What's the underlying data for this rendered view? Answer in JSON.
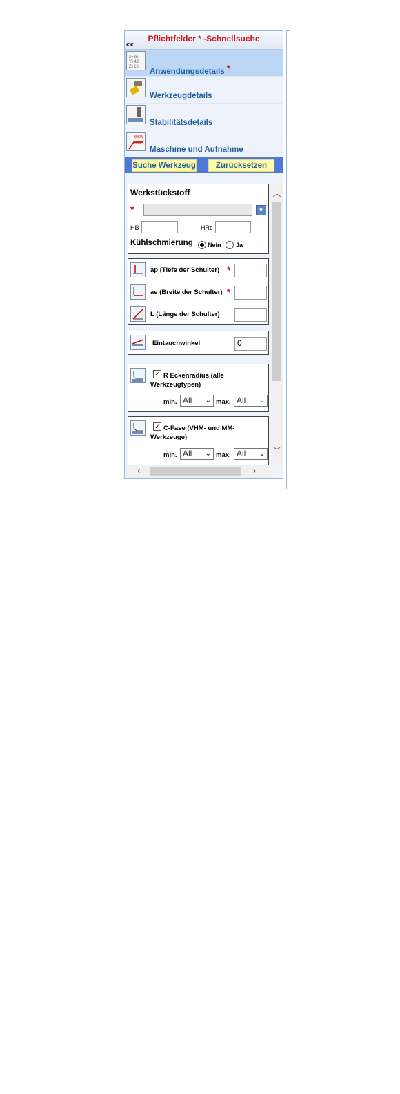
{
  "header": {
    "title": "Pflichtfelder * -Schnellsuche",
    "collapse": "<<"
  },
  "nav": [
    {
      "label": "Anwendungsdetails",
      "icon": "application-details-icon",
      "star": "*"
    },
    {
      "label": "Werkzeugdetails",
      "icon": "tool-details-icon"
    },
    {
      "label": "Stabilitätsdetails",
      "icon": "stability-details-icon"
    },
    {
      "label": "Maschine und Aufnahme",
      "icon": "machine-holder-icon"
    }
  ],
  "actions": {
    "search": "Suche Werkzeug",
    "reset": "Zurücksetzen"
  },
  "workpiece": {
    "title": "Werkstückstoff",
    "required_mark": "*",
    "hb_label": "HB",
    "hrc_label": "HRc",
    "hb_value": "",
    "hrc_value": "",
    "coolant_label": "Kühlschmierung",
    "coolant_options": [
      "Nein",
      "Ja"
    ],
    "coolant_selected": "Nein"
  },
  "shoulder": {
    "ap_label": "ap (Tiefe der Schulter)",
    "ae_label": "ae (Breite der Schulter)",
    "l_label": "L (Länge der Schulter)",
    "required_mark": "*"
  },
  "plunge": {
    "label": "Eintauchwinkel",
    "value": "0"
  },
  "corner_radius": {
    "label": "R Eckenradius (alle Werkzeugtypen)",
    "min_label": "min.",
    "max_label": "max.",
    "min_value": "All",
    "max_value": "All",
    "checked": true
  },
  "chamfer": {
    "label": "C-Fase (VHM- und MM-Werkzeuge)",
    "min_label": "min.",
    "max_label": "max.",
    "min_value": "All",
    "max_value": "All",
    "checked": true
  }
}
